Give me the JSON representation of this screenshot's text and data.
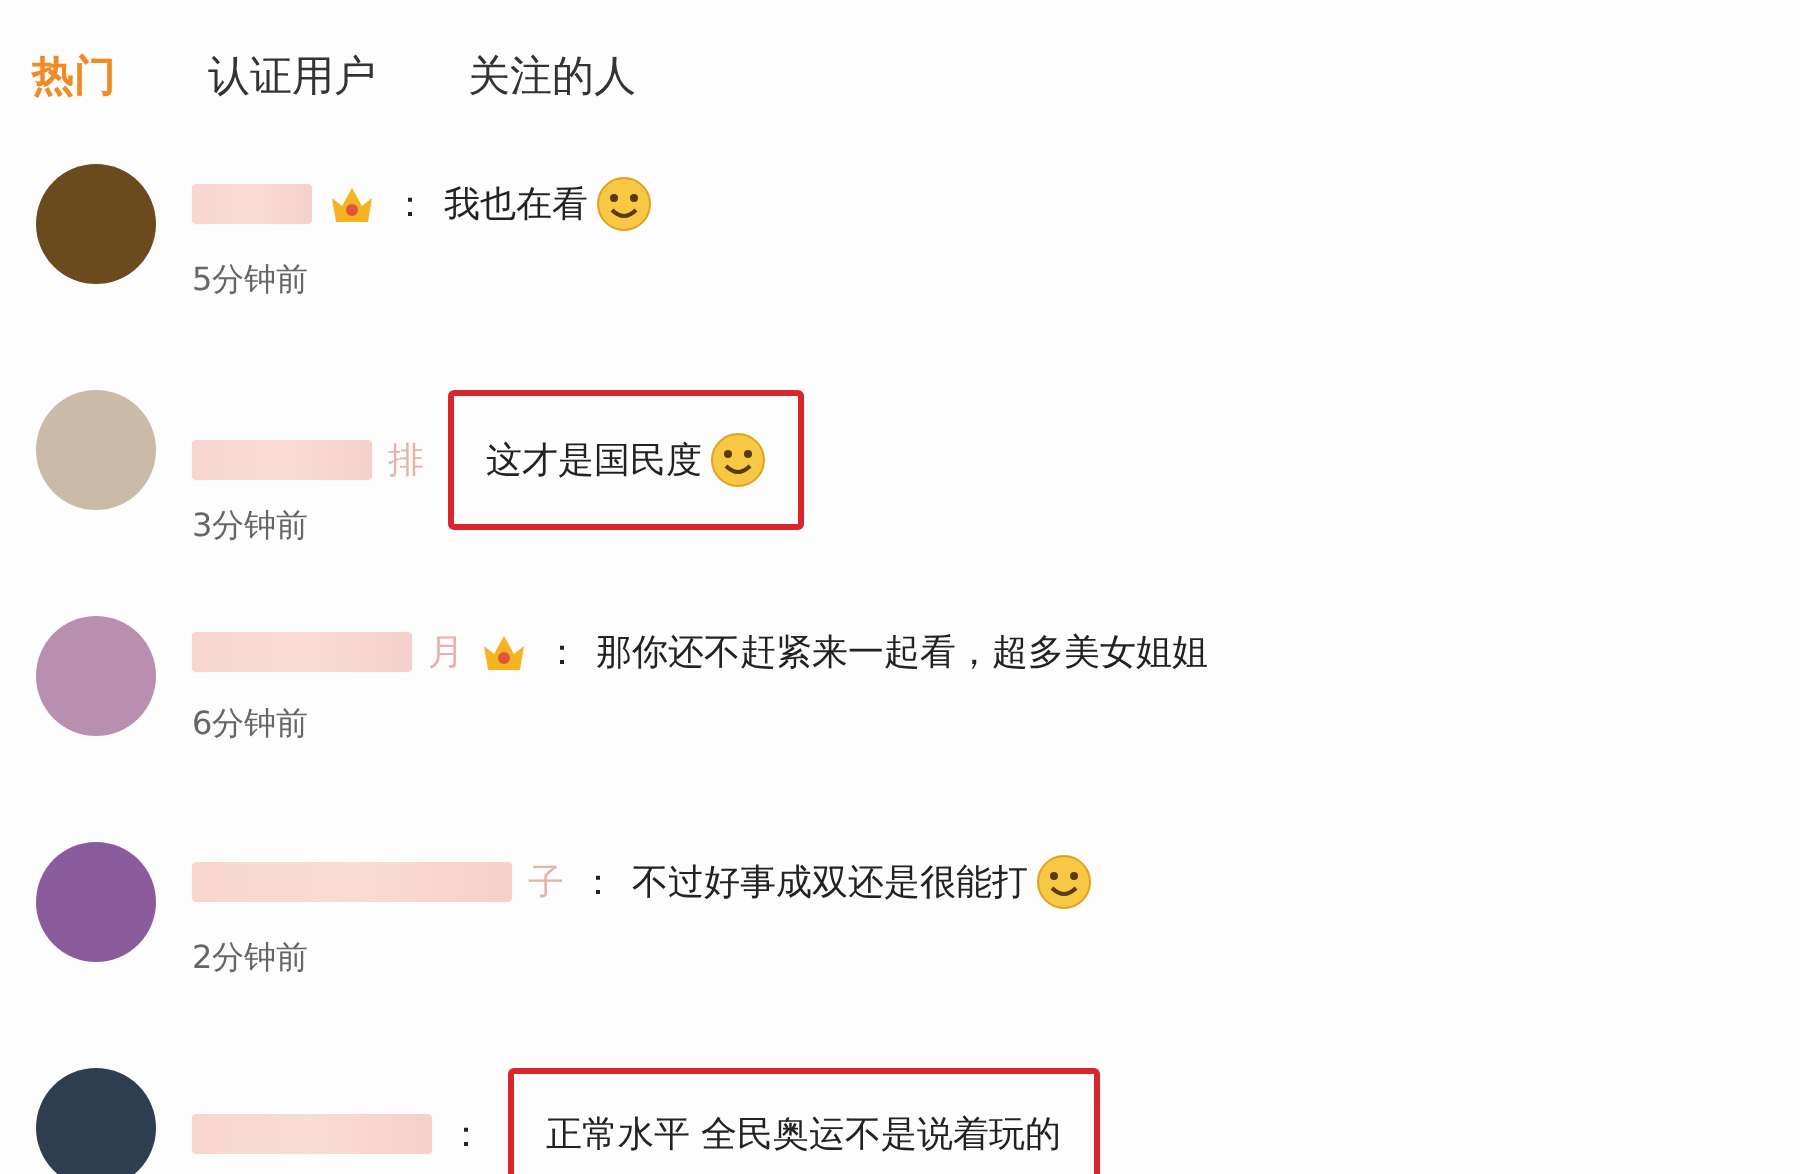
{
  "tabs": [
    {
      "label": "热门",
      "selected": true
    },
    {
      "label": "认证用户",
      "selected": false
    },
    {
      "label": "关注的人",
      "selected": false
    }
  ],
  "comments": [
    {
      "badge": true,
      "separator": "：",
      "text": "我也在看",
      "emoji": true,
      "highlighted": false,
      "time": "5分钟前"
    },
    {
      "name_tail": "排",
      "badge": false,
      "text": "这才是国民度",
      "emoji": true,
      "highlighted": true,
      "time": "3分钟前"
    },
    {
      "name_tail": "月",
      "badge": true,
      "separator": "：",
      "text": "那你还不赶紧来一起看，超多美女姐姐",
      "emoji": false,
      "highlighted": false,
      "time": "6分钟前"
    },
    {
      "name_tail": "子",
      "badge": false,
      "separator": "：",
      "text": "不过好事成双还是很能打",
      "emoji": true,
      "highlighted": false,
      "time": "2分钟前"
    },
    {
      "badge": false,
      "separator": "：",
      "text": "正常水平 全民奥运不是说着玩的",
      "emoji": false,
      "highlighted": true
    }
  ]
}
